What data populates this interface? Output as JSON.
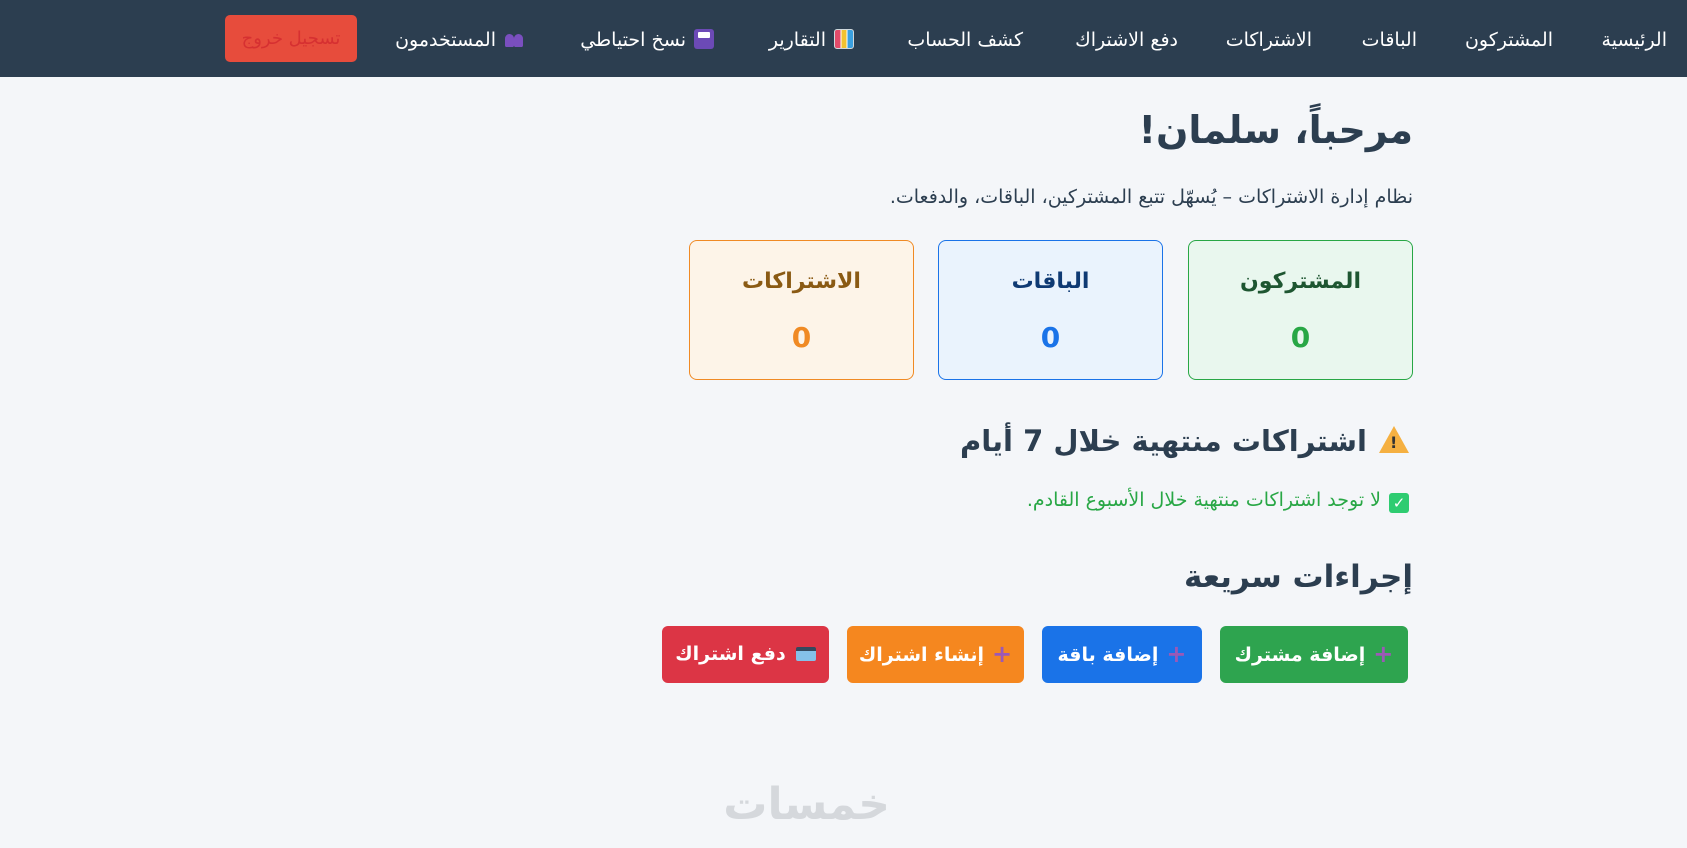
{
  "nav": {
    "home": "الرئيسية",
    "subscribers": "المشتركون",
    "packages": "الباقات",
    "subscriptions": "الاشتراكات",
    "pay_subscription": "دفع الاشتراك",
    "statement": "كشف الحساب",
    "reports": "التقارير",
    "backup": "نسخ احتياطي",
    "users": "المستخدمون",
    "logout": "تسجيل خروج"
  },
  "main": {
    "greeting": "مرحباً، سلمان!",
    "subtitle": "نظام إدارة الاشتراكات – يُسهّل تتبع المشتركين، الباقات، والدفعات."
  },
  "stats": [
    {
      "label": "المشتركون",
      "value": "0",
      "color": "#28a745"
    },
    {
      "label": "الباقات",
      "value": "0",
      "color": "#1a73e8"
    },
    {
      "label": "الاشتراكات",
      "value": "0",
      "color": "#f08a24"
    }
  ],
  "expiring": {
    "title": "اشتراكات منتهية خلال 7 أيام",
    "empty_message": "لا توجد اشتراكات منتهية خلال الأسبوع القادم."
  },
  "quick_actions": {
    "title": "إجراءات سريعة",
    "add_subscriber": "إضافة مشترك",
    "add_package": "إضافة باقة",
    "create_subscription": "إنشاء اشتراك",
    "pay_subscription": "دفع اشتراك"
  },
  "watermark": "خمسات",
  "icons": {
    "reports": "bar-chart-icon",
    "backup": "floppy-disk-icon",
    "users": "users-icon",
    "warning": "warning-icon",
    "check": "check-icon",
    "plus": "plus-icon",
    "card": "credit-card-icon"
  },
  "colors": {
    "nav_bg": "#2c3e50",
    "logout": "#e74c3c",
    "success": "#2ea44f",
    "primary": "#1a73e8",
    "orange": "#f5871f",
    "danger": "#dc3545"
  }
}
